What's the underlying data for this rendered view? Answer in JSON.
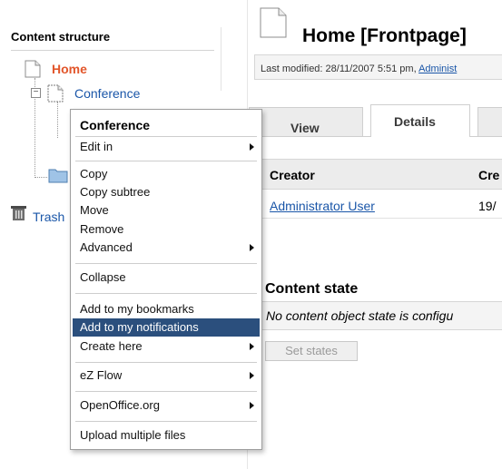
{
  "tree": {
    "heading": "Content structure",
    "home": "Home",
    "conference": "Conference",
    "toggle": "−",
    "trash": "Trash"
  },
  "header": {
    "title": "Home [Frontpage]",
    "modified_prefix": "Last modified: 28/11/2007 5:51 pm, ",
    "modified_user": "Administ"
  },
  "tabs": [
    "View",
    "Details",
    ""
  ],
  "table": {
    "headers": [
      "Creator",
      "Cre"
    ],
    "row": [
      "Administrator User",
      "19/"
    ]
  },
  "content_state": {
    "heading": "Content state",
    "message": "No content object state is configu",
    "button": "Set states"
  },
  "context_menu": {
    "title": "Conference",
    "items": [
      "Edit in",
      "Copy",
      "Copy subtree",
      "Move",
      "Remove",
      "Advanced",
      "Collapse",
      "Add to my bookmarks",
      "Add to my notifications",
      "Create here",
      "eZ Flow",
      "OpenOffice.org",
      "Upload multiple files"
    ],
    "highlighted_item": "Add to my notifications"
  },
  "colors": {
    "home_orange": "#e2562b",
    "link_blue": "#1a56a8",
    "highlight": "#2b4f7d"
  }
}
